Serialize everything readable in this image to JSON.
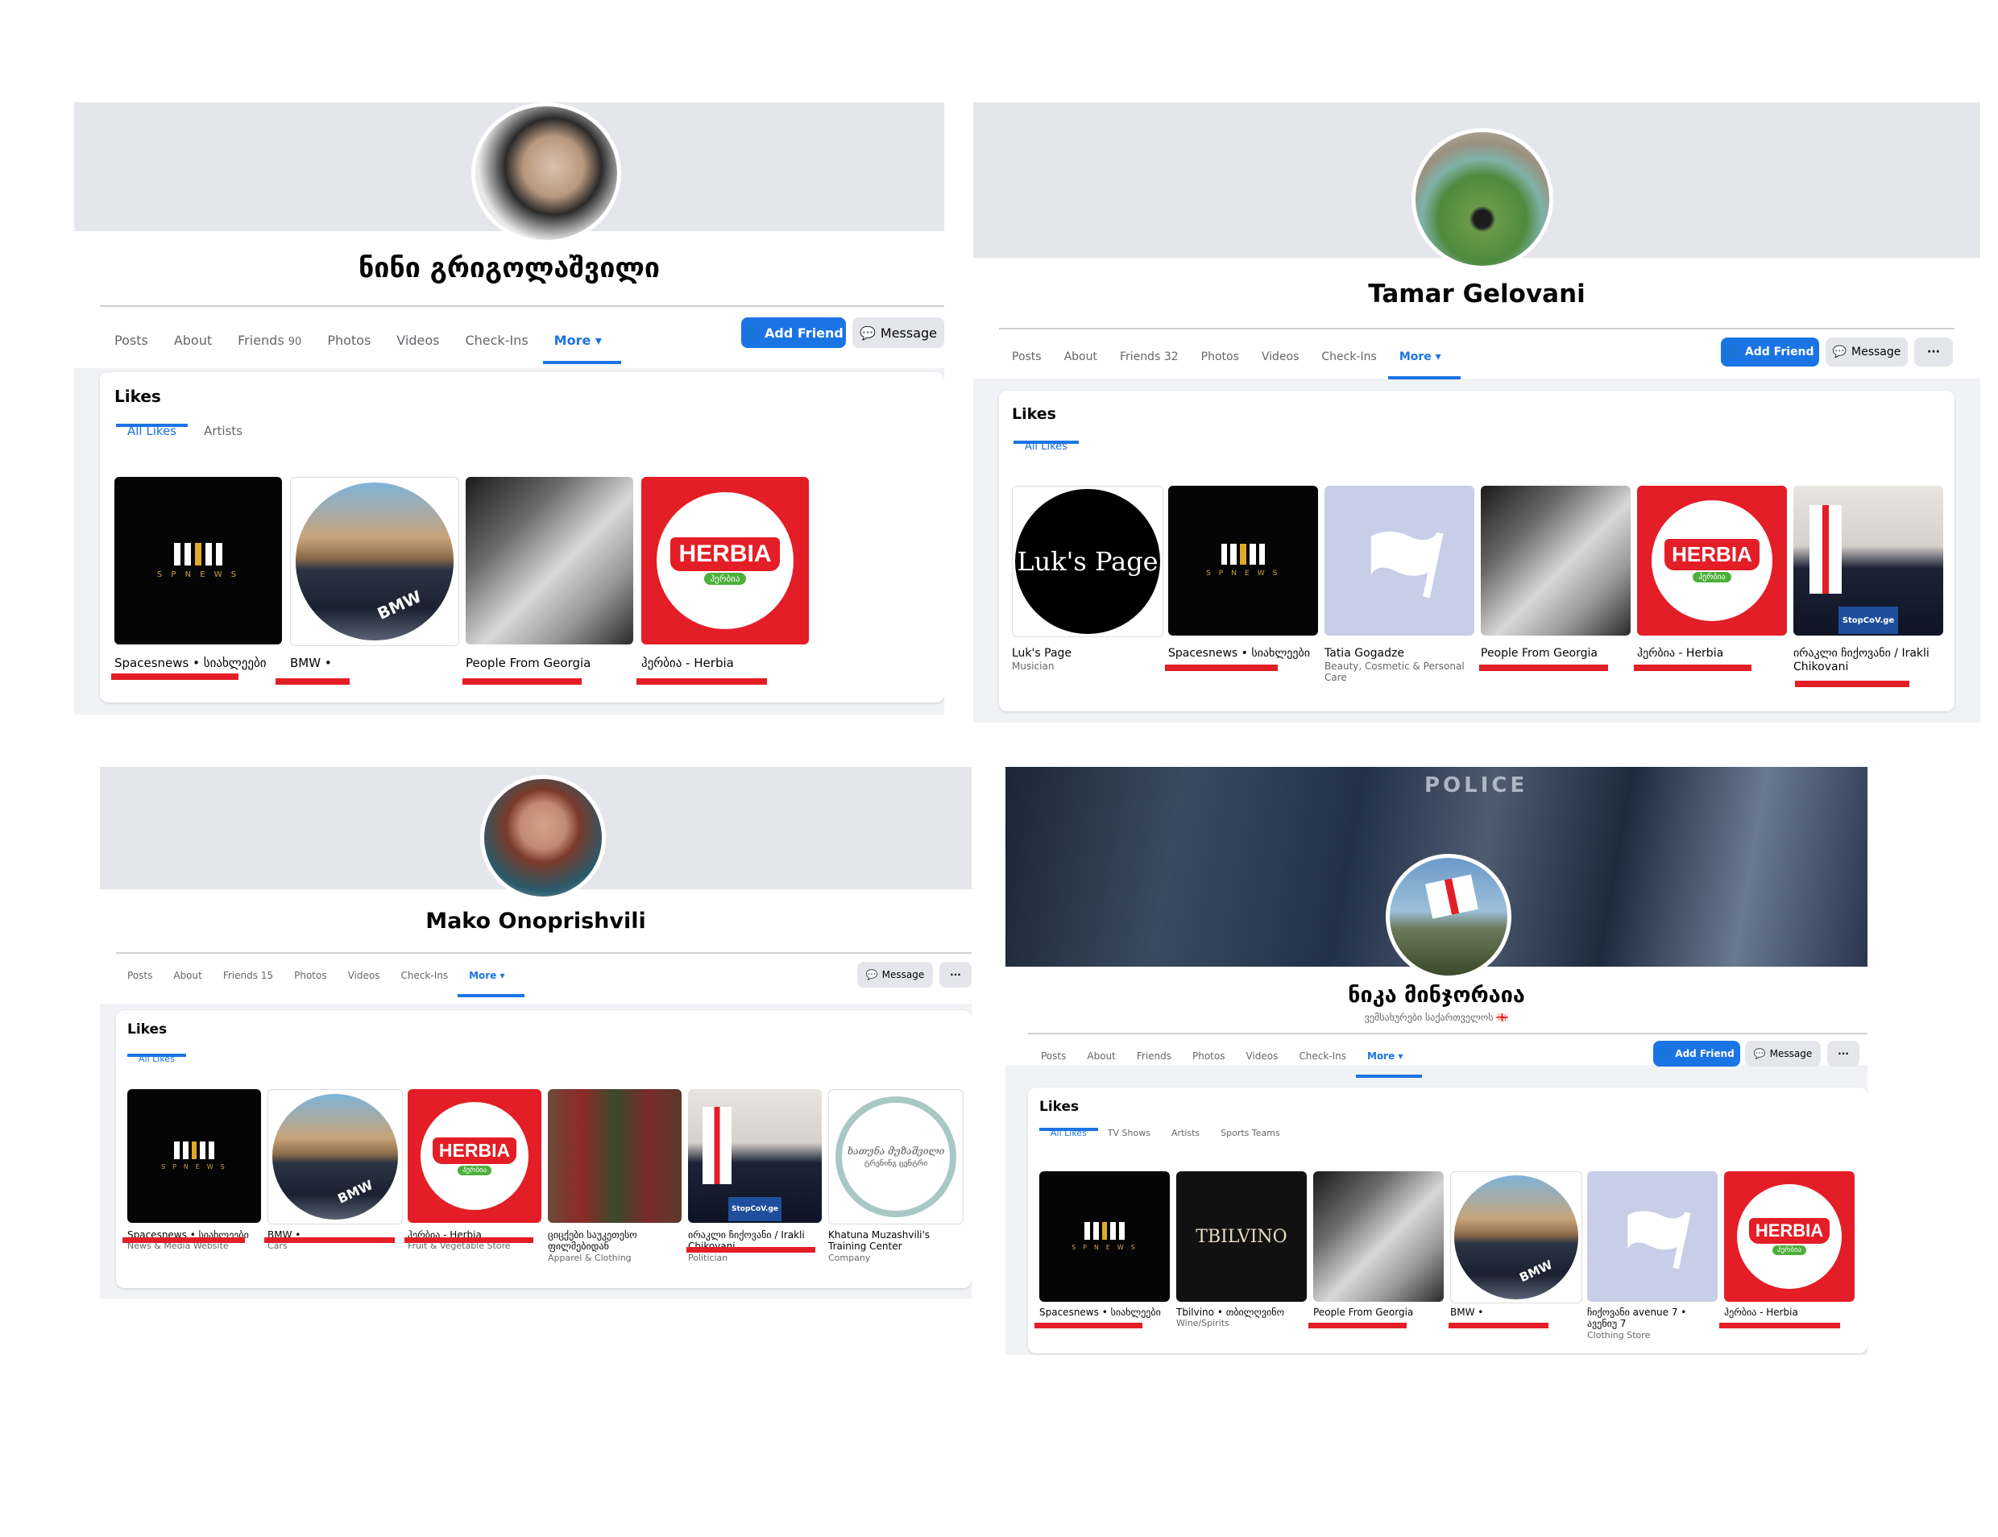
{
  "profiles": [
    {
      "name": "ნინი გრიგოლაშვილი",
      "nav": {
        "posts": "Posts",
        "about": "About",
        "friends": "Friends",
        "friends_count": "90",
        "photos": "Photos",
        "videos": "Videos",
        "checkins": "Check-Ins",
        "more": "More ▾"
      },
      "buttons": {
        "add_friend": "Add Friend",
        "message": "Message"
      },
      "likes": {
        "title": "Likes",
        "tabs": [
          "All Likes",
          "Artists"
        ],
        "items": [
          {
            "name": "Spacesnews • სიახლეები",
            "category": ""
          },
          {
            "name": "BMW •",
            "category": ""
          },
          {
            "name": "People From Georgia",
            "category": ""
          },
          {
            "name": "ჰერბია - Herbia",
            "category": ""
          }
        ]
      }
    },
    {
      "name": "Tamar Gelovani",
      "nav": {
        "posts": "Posts",
        "about": "About",
        "friends": "Friends",
        "friends_count": "32",
        "photos": "Photos",
        "videos": "Videos",
        "checkins": "Check-Ins",
        "more": "More ▾"
      },
      "buttons": {
        "add_friend": "Add Friend",
        "message": "Message",
        "overflow": "···"
      },
      "likes": {
        "title": "Likes",
        "tabs": [
          "All Likes"
        ],
        "items": [
          {
            "name": "Luk's Page",
            "category": "Musician"
          },
          {
            "name": "Spacesnews • სიახლეები",
            "category": ""
          },
          {
            "name": "Tatia Gogadze",
            "category": "Beauty, Cosmetic & Personal Care"
          },
          {
            "name": "People From Georgia",
            "category": ""
          },
          {
            "name": "ჰერბია - Herbia",
            "category": ""
          },
          {
            "name": "ირაკლი ჩიქოვანი / Irakli Chikovani",
            "category": ""
          }
        ]
      }
    },
    {
      "name": "Mako Onoprishvili",
      "nav": {
        "posts": "Posts",
        "about": "About",
        "friends": "Friends",
        "friends_count": "15",
        "photos": "Photos",
        "videos": "Videos",
        "checkins": "Check-Ins",
        "more": "More ▾"
      },
      "buttons": {
        "message": "Message",
        "overflow": "···"
      },
      "likes": {
        "title": "Likes",
        "tabs": [
          "All Likes"
        ],
        "items": [
          {
            "name": "Spacesnews • სიახლეები",
            "category": "News & Media Website"
          },
          {
            "name": "BMW •",
            "category": "Cars"
          },
          {
            "name": "ჰერბია - Herbia",
            "category": "Fruit & Vegetable Store"
          },
          {
            "name": "ციცქები საუკეთესო ფილმებიდან",
            "category": "Apparel & Clothing"
          },
          {
            "name": "ირაკლი ჩიქოვანი / Irakli Chikovani",
            "category": "Politician"
          },
          {
            "name": "Khatuna Muzashvili's Training Center",
            "category": "Company"
          }
        ]
      }
    },
    {
      "name": "ნიკა მინჯორაია",
      "subtitle": "ვემსახურები საქართველოს 🇬🇪",
      "nav": {
        "posts": "Posts",
        "about": "About",
        "friends": "Friends",
        "friends_count": "",
        "photos": "Photos",
        "videos": "Videos",
        "checkins": "Check-Ins",
        "more": "More ▾"
      },
      "buttons": {
        "add_friend": "Add Friend",
        "message": "Message",
        "overflow": "···"
      },
      "likes": {
        "title": "Likes",
        "tabs": [
          "All Likes",
          "TV Shows",
          "Artists",
          "Sports Teams"
        ],
        "items": [
          {
            "name": "Spacesnews • სიახლეები",
            "category": ""
          },
          {
            "name": "Tbilvino • თბილღვინო",
            "category": "Wine/Spirits"
          },
          {
            "name": "People From Georgia",
            "category": ""
          },
          {
            "name": "BMW •",
            "category": ""
          },
          {
            "name": "ჩიქოვანი avenue 7 • ავენიუ 7",
            "category": "Clothing Store"
          },
          {
            "name": "ჰერბია - Herbia",
            "category": ""
          }
        ]
      }
    }
  ],
  "tile_text": {
    "spn_sub": "S P N E W S",
    "herbia": "HERBIA",
    "herbia_sub": "ჰერბია",
    "bmw": "BMW",
    "luk": "Luk's Page",
    "stopcov": "StopCoV.ge",
    "tbilvino": "TBILVINO",
    "khatuna": "ხათუნა მუზაშვილი",
    "khatuna_sub": "ტრენინგ ცენტრი",
    "police": "POLICE"
  },
  "colors": {
    "accent": "#1b74e4",
    "redaction": "#e41e26",
    "herbia_red": "#e41e26"
  }
}
